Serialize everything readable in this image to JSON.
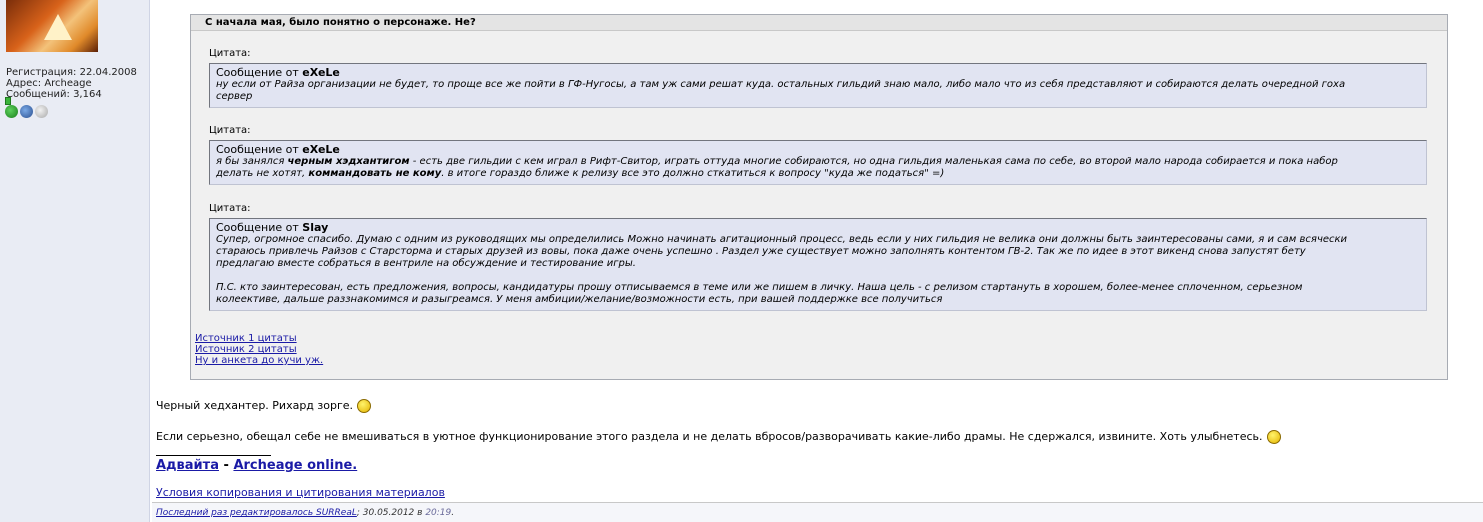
{
  "user": {
    "registration_label": "Регистрация:",
    "registration_date": "22.04.2008",
    "address_label": "Адрес:",
    "address_value": "Archeage",
    "messages_label": "Сообщений:",
    "messages_count": "3,164"
  },
  "outer_quote": {
    "title": "С начала мая, было понятно о персонаже. Не?"
  },
  "quotes": [
    {
      "label": "Цитата:",
      "from_prefix": "Сообщение от",
      "author": "eXeLe",
      "line1": "ну если от Райза организации не будет, то проще все же пойти в ГФ-Нугосы, а там уж сами решат куда. остальных гильдий знаю мало, либо мало что из себя представляют и собираются делать очередной гоха",
      "line2": "сервер"
    },
    {
      "label": "Цитата:",
      "from_prefix": "Сообщение от",
      "author": "eXeLe",
      "l1a": "я бы занялся ",
      "l1b": "черным хэдхантигом",
      "l1c": " - есть две гильдии с кем играл в Рифт-Свитор, играть оттуда многие собираются, но одна гильдия маленькая сама по себе, во второй мало народа собирается и пока набор",
      "l2a": "делать не хотят, ",
      "l2b": "коммандовать не кому",
      "l2c": ". в итоге гораздо ближе к релизу все это должно сткатиться к вопросу \"куда же податься\" =)"
    },
    {
      "label": "Цитата:",
      "from_prefix": "Сообщение от",
      "author": "Slay",
      "line1": "Супер, огромное спасибо. Думаю с одним из руководящих мы определились Можно начинать агитационный процесс, ведь если у них гильдия не велика они должны быть заинтересованы сами, я и сам всячески",
      "line2": "стараюсь привлечь Райзов с Старсторма и старых друзей из вовы, пока даже очень успешно . Раздел уже существует можно заполнять контентом ГВ-2. Так же по идее в этот викенд снова запустят бету",
      "line3": "предлагаю вместе собраться в вентриле на обсуждение и тестирование игры.",
      "line4": "П.С. кто заинтересован, есть предложения, вопросы, кандидатуры прошу отписываемся в теме или же пишем в личку. Наша цель - с релизом стартануть в хорошем, более-менее сплоченном, серьезном",
      "line5": "колеективе, дальше раззнакомимся и разыгреамся. У меня амбиции/желание/возможности есть, при вашей поддержке все получиться"
    }
  ],
  "source_links": [
    "Источник 1 цитаты",
    "Источник 2 цитаты",
    "Ну и анкета до кучи уж."
  ],
  "post": {
    "line1": "Черный хедхантер. Рихард зорге.",
    "line2": "Если серьезно, обещал себе не вмешиваться в уютное функционирование этого раздела и не делать вбросов/разворачивать какие-либо драмы. Не сдержался, извините. Хоть улыбнетесь."
  },
  "signature": {
    "link1": "Адвайта",
    "separator": " - ",
    "link2": "Archeage online.",
    "terms": "Условия копирования и цитирования материалов"
  },
  "edit": {
    "text": "Последний раз редактировалось SURReaL",
    "date": "; 30.05.2012 в ",
    "time": "20:19",
    "tail": "."
  }
}
